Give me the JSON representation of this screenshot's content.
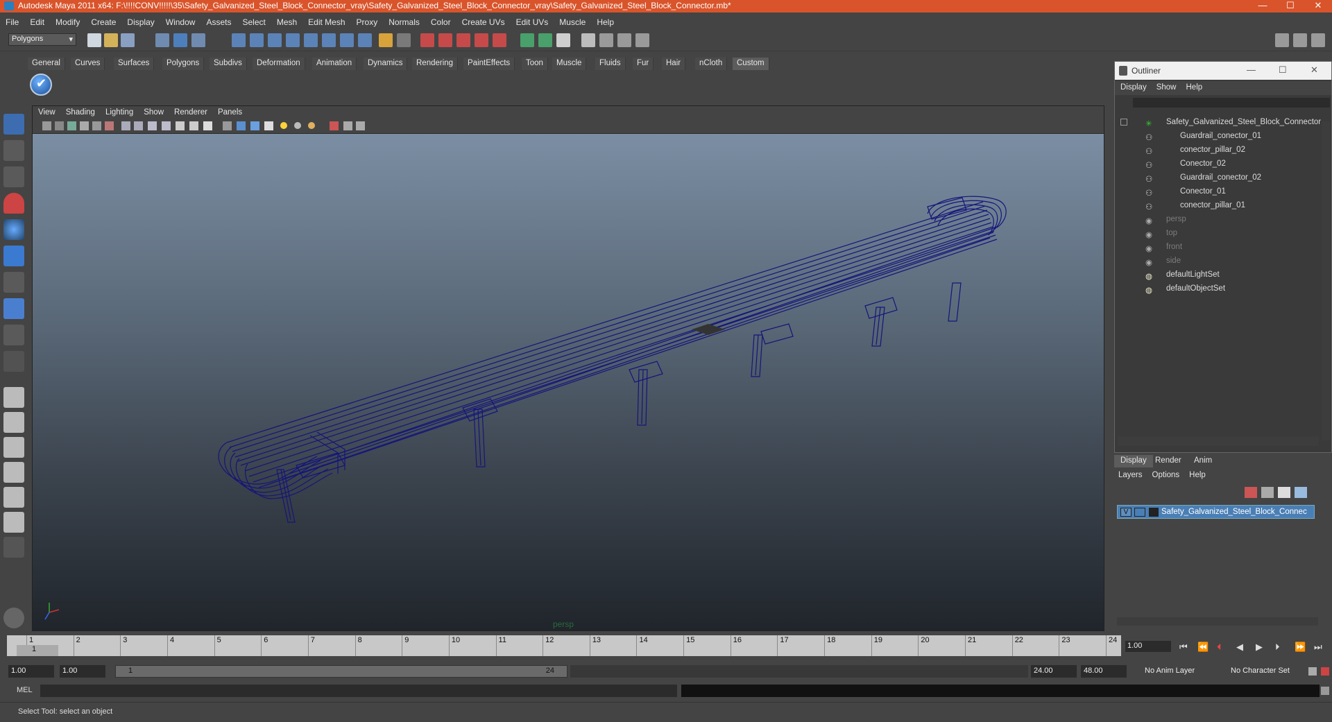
{
  "window": {
    "title": "Autodesk Maya 2011 x64: F:\\!!!!CONV!!!!!\\35\\Safety_Galvanized_Steel_Block_Connector_vray\\Safety_Galvanized_Steel_Block_Connector_vray\\Safety_Galvanized_Steel_Block_Connector.mb*",
    "minimize": "—",
    "maximize": "☐",
    "close": "✕",
    "accent": "#d9542b"
  },
  "menu": [
    "File",
    "Edit",
    "Modify",
    "Create",
    "Display",
    "Window",
    "Assets",
    "Select",
    "Mesh",
    "Edit Mesh",
    "Proxy",
    "Normals",
    "Color",
    "Create UVs",
    "Edit UVs",
    "Muscle",
    "Help"
  ],
  "status": {
    "mode": "Polygons"
  },
  "shelf": {
    "tabs": [
      "General",
      "Curves",
      "Surfaces",
      "Polygons",
      "Subdivs",
      "Deformation",
      "Animation",
      "Dynamics",
      "Rendering",
      "PaintEffects",
      "Toon",
      "Muscle",
      "Fluids",
      "Fur",
      "Hair",
      "nCloth",
      "Custom"
    ],
    "active": "Custom"
  },
  "viewport": {
    "menu": [
      "View",
      "Shading",
      "Lighting",
      "Show",
      "Renderer",
      "Panels"
    ],
    "camera_label": "persp",
    "wire_color": "#15157a"
  },
  "outliner": {
    "title": "Outliner",
    "menu": [
      "Display",
      "Show",
      "Help"
    ],
    "root": "Safety_Galvanized_Steel_Block_Connector",
    "children": [
      "Guardrail_conector_01",
      "conector_pillar_02",
      "Conector_02",
      "Guardrail_conector_02",
      "Conector_01",
      "conector_pillar_01"
    ],
    "cameras": [
      "persp",
      "top",
      "front",
      "side"
    ],
    "sets": [
      "defaultLightSet",
      "defaultObjectSet"
    ]
  },
  "layers": {
    "tabs": [
      "Display",
      "Render",
      "Anim"
    ],
    "active_tab": "Display",
    "menu": [
      "Layers",
      "Options",
      "Help"
    ],
    "layer_name": "Safety_Galvanized_Steel_Block_Connector_",
    "visible_flag": "V"
  },
  "timeline": {
    "start": 1,
    "end": 24,
    "ticks": [
      "1",
      "2",
      "3",
      "4",
      "5",
      "6",
      "7",
      "8",
      "9",
      "10",
      "11",
      "12",
      "13",
      "14",
      "15",
      "16",
      "17",
      "18",
      "19",
      "20",
      "21",
      "22",
      "23",
      "24"
    ],
    "current_frame": "1.00",
    "current_marker": "1"
  },
  "range": {
    "start_field": "1.00",
    "start2_field": "1.00",
    "slider_start": "1",
    "slider_end": "24",
    "end_field": "24.00",
    "end2_field": "48.00",
    "anim_layer": "No Anim Layer",
    "char_set": "No Character Set"
  },
  "cmd": {
    "label": "MEL"
  },
  "help": {
    "text": "Select Tool: select an object"
  }
}
